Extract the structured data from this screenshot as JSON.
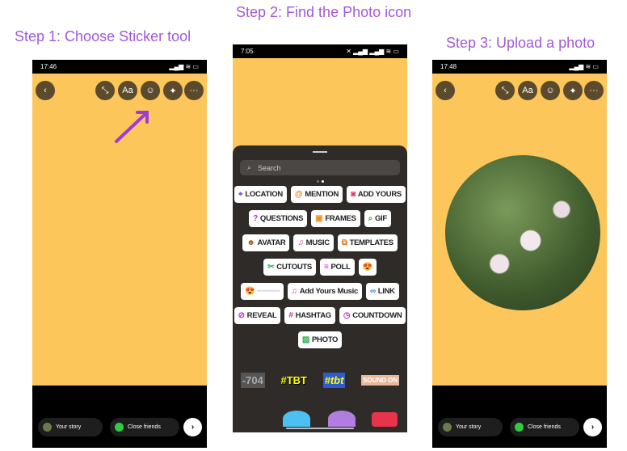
{
  "steps": [
    "Step 1: Choose Sticker tool",
    "Step 2: Find the Photo  icon",
    "Step 3: Upload a photo"
  ],
  "phone1": {
    "time": "17:46",
    "status": "▂▄▆ ≋ ▭"
  },
  "phone2": {
    "time": "7:05",
    "status": "✕ ▂▄▆ ▂▄▆ ≋ ▭"
  },
  "phone3": {
    "time": "17:48",
    "status": "▂▄▆ ≋ ▭"
  },
  "toolbar": {
    "back": "‹",
    "resize": "⤡",
    "text": "Aa",
    "sticker": "☺",
    "effects": "✦",
    "more": "···"
  },
  "bottom": {
    "your_story": "Your story",
    "close_friends": "Close friends",
    "next": "›"
  },
  "search": {
    "placeholder": "Search",
    "icon": "⌕"
  },
  "stickers": [
    [
      {
        "icon": "⌖",
        "label": "LOCATION",
        "color": "#7b4de0"
      },
      {
        "icon": "@",
        "label": "MENTION",
        "color": "#f07a1a"
      },
      {
        "icon": "◙",
        "label": "ADD YOURS",
        "color": "#e0306a"
      }
    ],
    [
      {
        "icon": "?",
        "label": "QUESTIONS",
        "color": "#c02fd0"
      },
      {
        "icon": "▣",
        "label": "FRAMES",
        "color": "#f08a1a"
      },
      {
        "icon": "⌕",
        "label": "GIF",
        "color": "#2bb04a"
      }
    ],
    [
      {
        "icon": "☻",
        "label": "AVATAR",
        "color": "#a0642c"
      },
      {
        "icon": "♫",
        "label": "MUSIC",
        "color": "#d02f8a"
      },
      {
        "icon": "⧉",
        "label": "TEMPLATES",
        "color": "#f07a1a"
      }
    ],
    [
      {
        "icon": "✂",
        "label": "CUTOUTS",
        "color": "#2bb04a"
      },
      {
        "icon": "≡",
        "label": "POLL",
        "color": "#c02fd0"
      },
      {
        "icon": "😍",
        "label": "",
        "color": "#f5a623"
      }
    ],
    [
      {
        "icon": "😍",
        "label": "━━━━━",
        "color": "#ddd"
      },
      {
        "icon": "♫",
        "label": "Add Yours Music",
        "color": "#d02f8a"
      },
      {
        "icon": "∞",
        "label": "LINK",
        "color": "#2f7be0"
      }
    ],
    [
      {
        "icon": "⊘",
        "label": "REVEAL",
        "color": "#c02fd0"
      },
      {
        "icon": "#",
        "label": "HASHTAG",
        "color": "#d02f8a"
      },
      {
        "icon": "◷",
        "label": "COUNTDOWN",
        "color": "#c02fd0"
      }
    ],
    [
      {
        "icon": "▨",
        "label": "PHOTO",
        "color": "#2bb04a"
      }
    ]
  ],
  "gallery": [
    "-704",
    "#TBT",
    "#tbt",
    "SOUND ON"
  ],
  "colors": {
    "accent": "#a259d9",
    "story_bg": "#fcc65b",
    "button": "#5b4b2c"
  }
}
